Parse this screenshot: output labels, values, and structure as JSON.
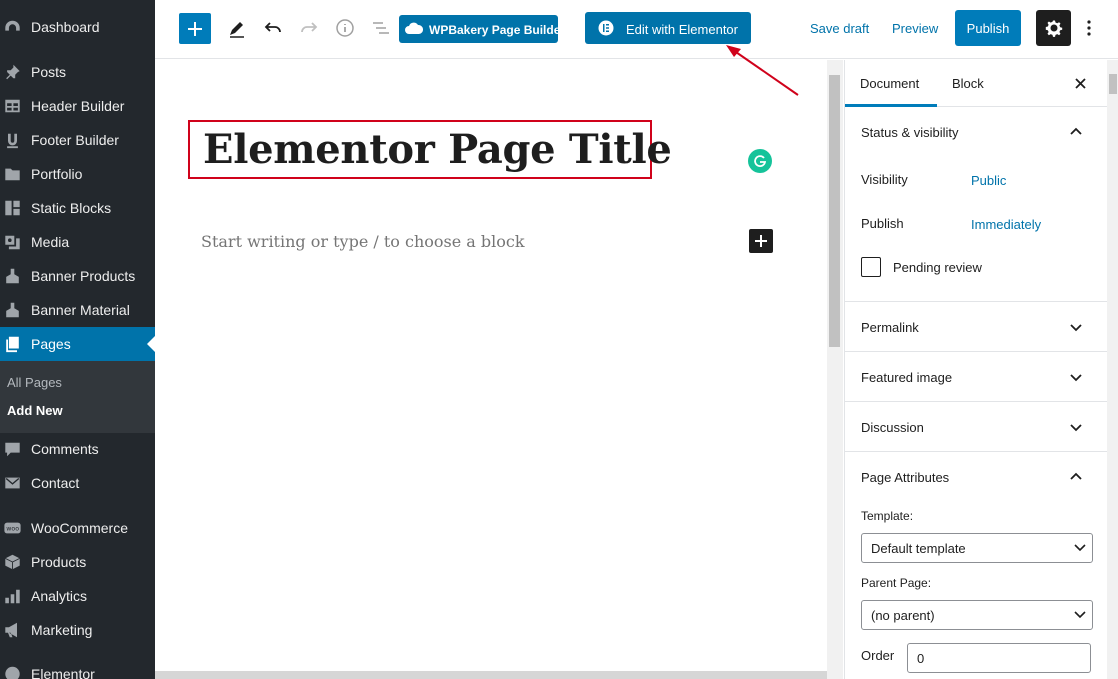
{
  "sidebar": {
    "items": [
      {
        "label": "Dashboard",
        "icon": "dashboard-icon"
      },
      {
        "label": "Posts",
        "icon": "pin-icon"
      },
      {
        "label": "Header Builder",
        "icon": "table-icon"
      },
      {
        "label": "Footer Builder",
        "icon": "u-icon"
      },
      {
        "label": "Portfolio",
        "icon": "folder-icon"
      },
      {
        "label": "Static Blocks",
        "icon": "blocks-icon"
      },
      {
        "label": "Media",
        "icon": "media-icon"
      },
      {
        "label": "Banner Products",
        "icon": "stamp-icon"
      },
      {
        "label": "Banner Material",
        "icon": "stamp-icon"
      },
      {
        "label": "Pages",
        "icon": "pages-icon"
      },
      {
        "label": "Comments",
        "icon": "comment-icon"
      },
      {
        "label": "Contact",
        "icon": "mail-icon"
      },
      {
        "label": "WooCommerce",
        "icon": "woo-icon"
      },
      {
        "label": "Products",
        "icon": "box-icon"
      },
      {
        "label": "Analytics",
        "icon": "bar-chart-icon"
      },
      {
        "label": "Marketing",
        "icon": "megaphone-icon"
      },
      {
        "label": "Elementor",
        "icon": "elementor-icon"
      }
    ],
    "submenu": [
      {
        "label": "All Pages"
      },
      {
        "label": "Add New"
      }
    ]
  },
  "toolbar": {
    "wpbakery_label": "WPBakery Page Builder",
    "elementor_label": "Edit with Elementor",
    "save_draft_label": "Save draft",
    "preview_label": "Preview",
    "publish_label": "Publish"
  },
  "editor": {
    "title": "Elementor Page Title",
    "placeholder": "Start writing or type / to choose a block"
  },
  "panel": {
    "tabs": [
      {
        "label": "Document"
      },
      {
        "label": "Block"
      }
    ],
    "status": {
      "title": "Status & visibility",
      "visibility_label": "Visibility",
      "visibility_value": "Public",
      "publish_label": "Publish",
      "publish_value": "Immediately",
      "pending_label": "Pending review"
    },
    "sections": [
      {
        "title": "Permalink"
      },
      {
        "title": "Featured image"
      },
      {
        "title": "Discussion"
      }
    ],
    "attributes": {
      "title": "Page Attributes",
      "template_label": "Template:",
      "template_value": "Default template",
      "parent_label": "Parent Page:",
      "parent_value": "(no parent)",
      "order_label": "Order",
      "order_value": "0"
    }
  },
  "colors": {
    "sidebar_bg": "#23282d",
    "accent": "#0073aa",
    "highlight_red": "#d0021b"
  }
}
